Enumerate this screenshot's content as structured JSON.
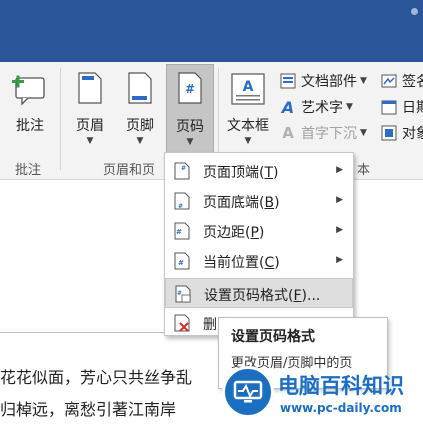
{
  "ribbon": {
    "comment_group": {
      "comment_button": "批注",
      "label": "批注"
    },
    "header_footer_group": {
      "header_button": "页眉",
      "footer_button": "页脚",
      "page_number_button": "页码",
      "label": "页眉和页"
    },
    "text_group": {
      "textbox_button": "文本框",
      "quick_parts": "文档部件",
      "wordart": "艺术字",
      "dropcap": "首字下沉",
      "signature": "签名",
      "datetime": "日期",
      "object": "对象",
      "label": "本"
    }
  },
  "menu": {
    "items": [
      {
        "label": "页面顶端(",
        "key": "T",
        "suffix": ")",
        "has_submenu": true
      },
      {
        "label": "页面底端(",
        "key": "B",
        "suffix": ")",
        "has_submenu": true
      },
      {
        "label": "页边距(",
        "key": "P",
        "suffix": ")",
        "has_submenu": true
      },
      {
        "label": "当前位置(",
        "key": "C",
        "suffix": ")",
        "has_submenu": true
      },
      {
        "label": "设置页码格式(",
        "key": "F",
        "suffix": ")...",
        "has_submenu": false,
        "highlighted": true
      },
      {
        "label": "删除页码",
        "key": "",
        "suffix": "",
        "has_submenu": false
      }
    ]
  },
  "tooltip": {
    "title": "设置页码格式",
    "body": "更改页眉/页脚中的页"
  },
  "document": {
    "line1": "花花似面，芳心只共丝争乱",
    "line2": "归棹远，离愁引著江南岸"
  },
  "watermark": {
    "name": "电脑百科知识",
    "url": "www.pc-daily.com"
  },
  "colors": {
    "titlebar": "#2b579a",
    "ribbon": "#f3f3f3",
    "watermark": "#1c6fc0",
    "icon_blue": "#2b6cc4"
  }
}
